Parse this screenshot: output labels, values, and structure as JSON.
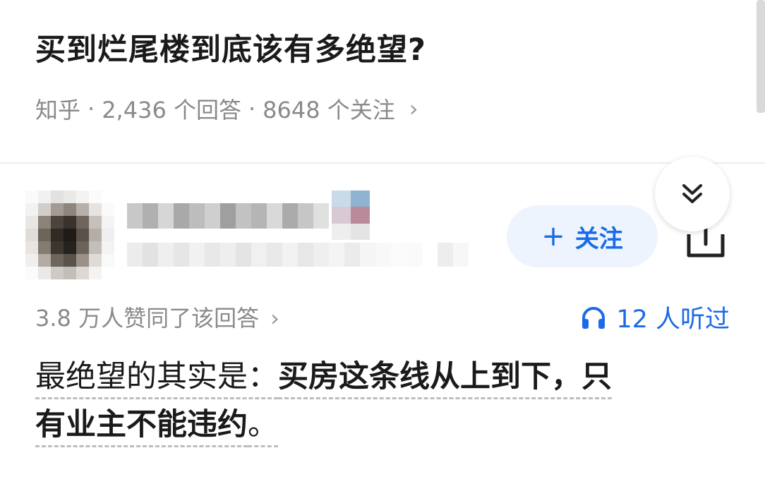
{
  "question": {
    "title": "买到烂尾楼到底该有多绝望?",
    "source": "知乎",
    "answers_count": "2,436 个回答",
    "followers_count": "8648 个关注"
  },
  "author": {
    "follow_label": "关注"
  },
  "answer_meta": {
    "upvotes_text": "3.8 万人赞同了该回答",
    "listen_text": "12 人听过"
  },
  "answer_body": {
    "line1_plain": "最绝望的其实是：",
    "line1_bold": "买房这条线从上到下，只",
    "line2_bold": "有业主不能违约",
    "line2_end": "。"
  },
  "colors": {
    "accent": "#1a6be6",
    "follow_bg": "#eef4fd",
    "meta_text": "#8a8a8a",
    "title_text": "#1a1a1a"
  },
  "icons": {
    "collapse": "double-chevron-down-icon",
    "share": "share-icon",
    "listen": "headphones-icon",
    "meta_chevron": "chevron-right-icon"
  }
}
